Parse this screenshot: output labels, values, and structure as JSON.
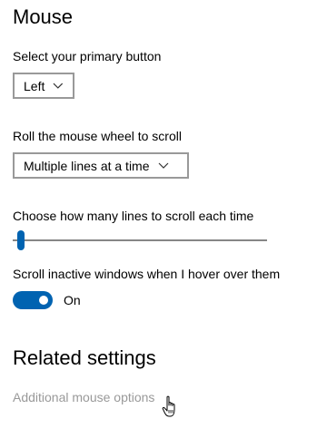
{
  "page": {
    "title": "Mouse"
  },
  "primary_button": {
    "label": "Select your primary button",
    "selected": "Left",
    "icon": "chevron-down-icon"
  },
  "scroll": {
    "label": "Roll the mouse wheel to scroll",
    "selected": "Multiple lines at a time",
    "icon": "chevron-down-icon"
  },
  "lines": {
    "label": "Choose how many lines to scroll each time",
    "value_fraction": 0.02
  },
  "inactive": {
    "label": "Scroll inactive windows when I hover over them",
    "state": "On",
    "on": true
  },
  "related": {
    "heading": "Related settings",
    "link": "Additional mouse options"
  },
  "colors": {
    "accent": "#0063b1",
    "link": "#999999",
    "border": "#999999"
  },
  "cursor": {
    "icon": "hand-pointer-icon"
  }
}
